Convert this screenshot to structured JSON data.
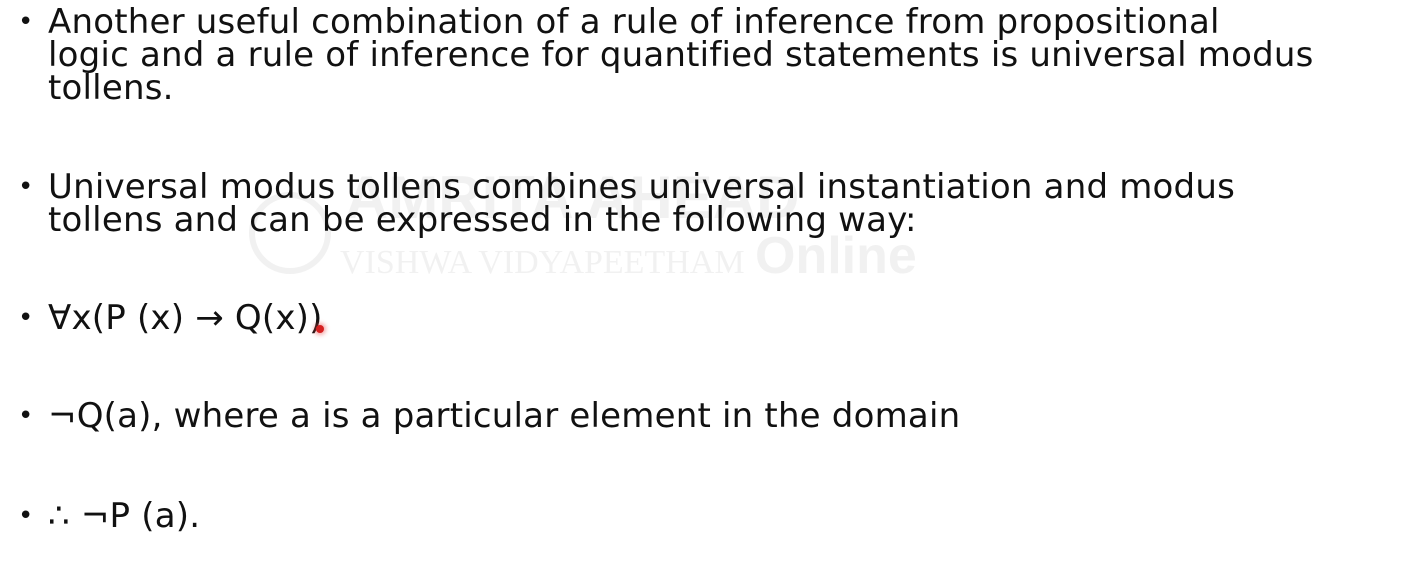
{
  "slide": {
    "bullets": [
      {
        "text": "Another useful combination of a rule of inference from propositional\nlogic and a rule of inference for quantified statements is universal modus\ntollens."
      },
      {
        "text": "Universal modus tollens combines universal instantiation and modus\ntollens and can be expressed in the following way:"
      },
      {
        "text": "∀x(P (x) → Q(x))"
      },
      {
        "text": "¬Q(a), where a is a particular element in the domain"
      },
      {
        "text": " ∴ ¬P (a)."
      }
    ],
    "bullet_symbol": "•",
    "watermark": {
      "line1": "AMRITA AHEAD",
      "line2": "VISHWA VIDYAPEETHAM",
      "line3": "Online"
    },
    "colors": {
      "text": "#111111",
      "pointer": "#d52020",
      "background": "#ffffff"
    }
  }
}
